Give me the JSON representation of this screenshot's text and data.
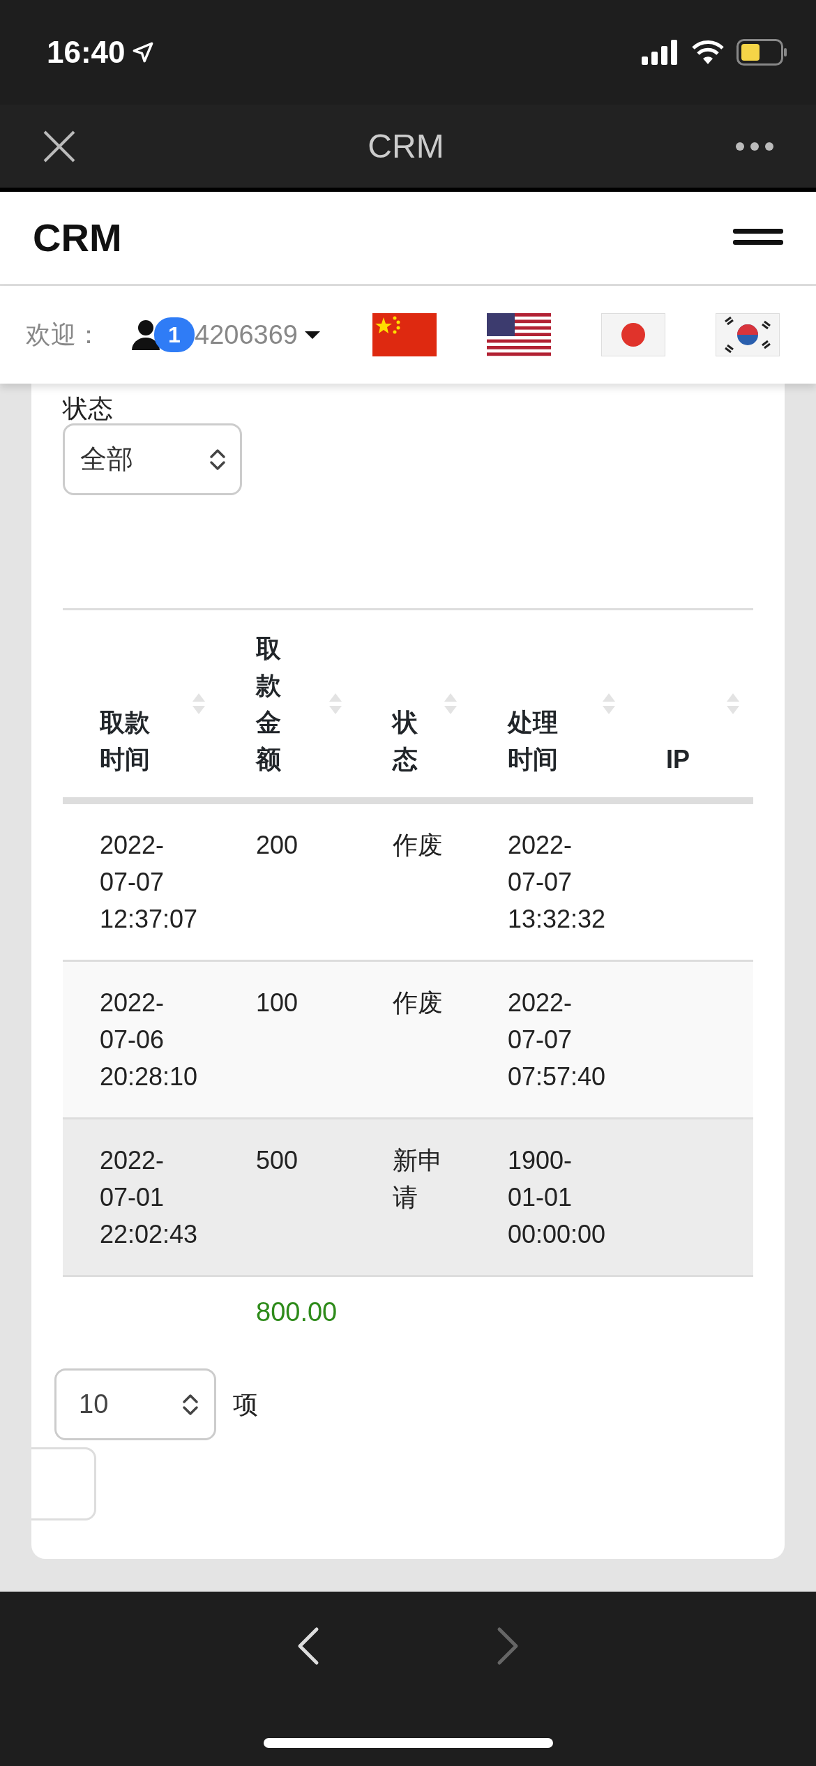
{
  "status_bar": {
    "time": "16:40"
  },
  "app_bar": {
    "title": "CRM"
  },
  "navbar": {
    "brand": "CRM"
  },
  "user_bar": {
    "welcome": "欢迎：",
    "badge": "1",
    "user_id": "4206369",
    "flags": [
      {
        "kind": "cn"
      },
      {
        "kind": "us"
      },
      {
        "kind": "jp"
      },
      {
        "kind": "kr"
      }
    ]
  },
  "filter": {
    "label": "状态",
    "value": "全部"
  },
  "table": {
    "columns": [
      "取款时间",
      "取款金额",
      "状态",
      "处理时间",
      "IP"
    ],
    "rows": [
      {
        "cells": [
          "2022-07-07 12:37:07",
          "200",
          "作废",
          "2022-07-07 13:32:32",
          ""
        ],
        "highlighted": false
      },
      {
        "cells": [
          "2022-07-06 20:28:10",
          "100",
          "作废",
          "2022-07-07 07:57:40",
          ""
        ],
        "highlighted": false
      },
      {
        "cells": [
          "2022-07-01 22:02:43",
          "500",
          "新申请",
          "1900-01-01 00:00:00",
          ""
        ],
        "highlighted": true
      }
    ],
    "total": "800.00"
  },
  "page_length": {
    "value": "10",
    "suffix": "项"
  }
}
